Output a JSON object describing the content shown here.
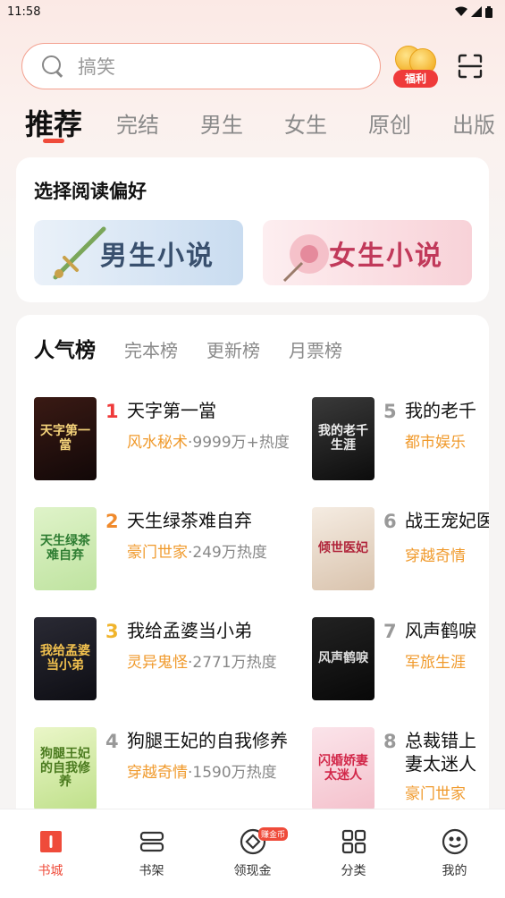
{
  "status_bar": {
    "time": "11:58"
  },
  "search": {
    "placeholder": "搞笑"
  },
  "welfare": {
    "label": "福利"
  },
  "tabs": [
    "推荐",
    "完结",
    "男生",
    "女生",
    "原创",
    "出版"
  ],
  "preference": {
    "title": "选择阅读偏好",
    "male_label": "男生小说",
    "female_label": "女生小说"
  },
  "ranking": {
    "tabs": [
      "人气榜",
      "完本榜",
      "更新榜",
      "月票榜"
    ],
    "rank_colors": [
      "#ef3a3a",
      "#f08a2c",
      "#f0b42c",
      "#999999"
    ],
    "books": [
      {
        "rank": "1",
        "title": "天字第一當",
        "genre": "风水秘术",
        "heat": "9999万+热度",
        "cover_text": "天字第一當"
      },
      {
        "rank": "2",
        "title": "天生绿茶难自弃",
        "genre": "豪门世家",
        "heat": "249万热度",
        "cover_text": "天生绿茶难自弃"
      },
      {
        "rank": "3",
        "title": "我给孟婆当小弟",
        "genre": "灵异鬼怪",
        "heat": "2771万热度",
        "cover_text": "我给孟婆当小弟"
      },
      {
        "rank": "4",
        "title": "狗腿王妃的自我修养",
        "genre": "穿越奇情",
        "heat": "1590万热度",
        "cover_text": "狗腿王妃的自我修养"
      },
      {
        "rank": "5",
        "title": "我的老千",
        "genre": "都市娱乐",
        "heat": "",
        "cover_text": "我的老千生涯"
      },
      {
        "rank": "6",
        "title": "战王宠妃医",
        "title_line2": "医",
        "genre": "穿越奇情",
        "heat": "",
        "cover_text": "倾世医妃"
      },
      {
        "rank": "7",
        "title": "风声鹤唳",
        "genre": "军旅生涯",
        "heat": "",
        "cover_text": "风声鹤唳"
      },
      {
        "rank": "8",
        "title": "总裁错上",
        "title_line2": "妻太迷人",
        "genre": "豪门世家",
        "heat": "",
        "cover_text": "闪婚娇妻太迷人"
      }
    ]
  },
  "bottom_nav": {
    "items": [
      "书城",
      "书架",
      "领现金",
      "分类",
      "我的"
    ],
    "badge": "赚金币"
  }
}
